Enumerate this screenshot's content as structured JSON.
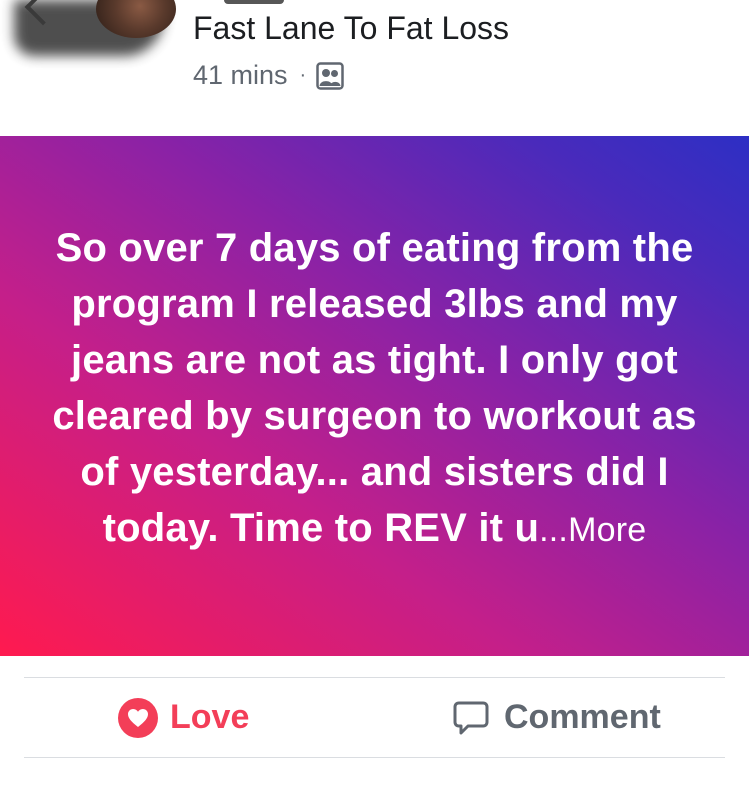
{
  "header": {
    "group_name": "Fast Lane To Fat Loss",
    "timestamp": "41 mins",
    "separator": "·",
    "audience_icon": "group-icon"
  },
  "post": {
    "status_text": "So over 7 days of eating from the program I released 3lbs and my jeans are not as tight. I only got cleared by surgeon to workout as of yesterday... and sisters did I today. Time to REV it u",
    "more_label": "...More",
    "background_colors": [
      "#ff1a4f",
      "#c41f8a",
      "#8a22a6",
      "#4a2abb",
      "#2d2fc4"
    ]
  },
  "actions": {
    "love_label": "Love",
    "comment_label": "Comment",
    "love_color": "#f33e58",
    "comment_color": "#606770"
  }
}
